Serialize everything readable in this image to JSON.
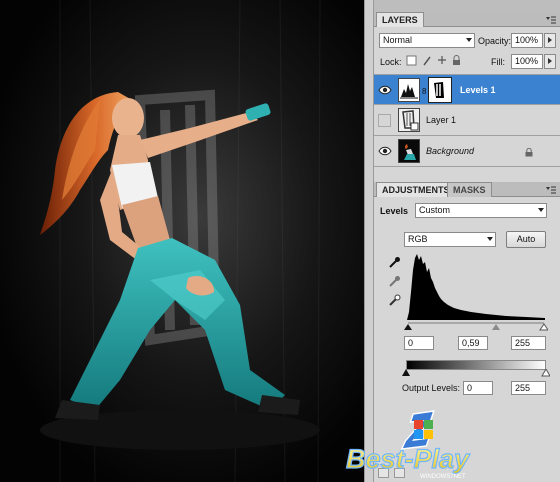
{
  "layers_panel": {
    "tab_label": "LAYERS",
    "blend_mode": "Normal",
    "opacity_label": "Opacity:",
    "opacity_value": "100%",
    "lock_label": "Lock:",
    "fill_label": "Fill:",
    "fill_value": "100%",
    "layers": [
      {
        "name": "Levels 1",
        "visible": true,
        "selected": true
      },
      {
        "name": "Layer 1",
        "visible": false,
        "selected": false
      },
      {
        "name": "Background",
        "visible": true,
        "selected": false,
        "locked": true
      }
    ]
  },
  "adjustments_panel": {
    "tabs": [
      "ADJUSTMENTS",
      "MASKS"
    ],
    "preset_label": "Levels",
    "preset_value": "Custom",
    "channel_value": "RGB",
    "auto_label": "Auto",
    "input_levels": [
      "0",
      "0,59",
      "255"
    ],
    "output_label": "Output Levels:",
    "output_levels": [
      "0",
      "255"
    ]
  },
  "watermark": {
    "text": "Best-Play",
    "subtext": "WINDOWS7NET"
  },
  "colors": {
    "selection": "#3b82d0",
    "panel_bg": "#d6d6d6",
    "turquoise": "#2aa7a8",
    "hair": "#c9551c"
  }
}
